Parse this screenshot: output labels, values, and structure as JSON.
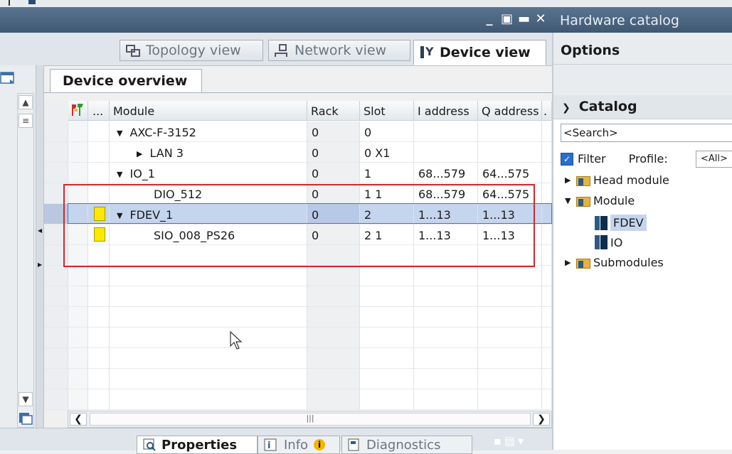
{
  "window": {
    "controls": [
      "_",
      "▣",
      "▬",
      "✕"
    ]
  },
  "view_tabs": [
    {
      "label": "Topology view",
      "icon": "topology-icon",
      "active": false
    },
    {
      "label": "Network view",
      "icon": "network-icon",
      "active": false
    },
    {
      "label": "Device view",
      "icon": "device-icon",
      "active": true
    }
  ],
  "overview": {
    "tab_label": "Device overview",
    "columns": [
      "...",
      "Module",
      "Rack",
      "Slot",
      "I address",
      "Q address"
    ],
    "rows": [
      {
        "module": "AXC-F-3152",
        "rack": "0",
        "slot": "0",
        "i_address": "",
        "q_address": "",
        "expander": "down",
        "indent": 0
      },
      {
        "module": "LAN 3",
        "rack": "0",
        "slot": "0 X1",
        "i_address": "",
        "q_address": "",
        "expander": "right",
        "indent": 1
      },
      {
        "module": "IO_1",
        "rack": "0",
        "slot": "1",
        "i_address": "68...579",
        "q_address": "64...575",
        "expander": "down",
        "indent": 0
      },
      {
        "module": "DIO_512",
        "rack": "0",
        "slot": "1 1",
        "i_address": "68...579",
        "q_address": "64...575",
        "expander": "",
        "indent": 2
      },
      {
        "module": "FDEV_1",
        "rack": "0",
        "slot": "2",
        "i_address": "1...13",
        "q_address": "1...13",
        "expander": "down",
        "indent": 0,
        "selected": true,
        "flag": true
      },
      {
        "module": "SIO_008_PS26",
        "rack": "0",
        "slot": "2 1",
        "i_address": "1...13",
        "q_address": "1...13",
        "expander": "",
        "indent": 2,
        "flag": true
      }
    ]
  },
  "bottom_tabs": [
    {
      "label": "Properties",
      "active": true
    },
    {
      "label": "Info",
      "active": false
    },
    {
      "label": "Diagnostics",
      "active": false
    }
  ],
  "catalog_panel": {
    "title": "Hardware catalog",
    "options_label": "Options",
    "catalog_label": "Catalog",
    "search_placeholder": "<Search>",
    "filter_label": "Filter",
    "profile_label": "Profile:",
    "profile_value": "<All>",
    "tree": [
      {
        "label": "Head module",
        "expander": "right",
        "level": 0,
        "icon": "folder"
      },
      {
        "label": "Module",
        "expander": "down",
        "level": 0,
        "icon": "folder"
      },
      {
        "label": "FDEV",
        "expander": "",
        "level": 1,
        "icon": "module",
        "selected": true
      },
      {
        "label": "IO",
        "expander": "",
        "level": 1,
        "icon": "module"
      },
      {
        "label": "Submodules",
        "expander": "right",
        "level": 0,
        "icon": "folder"
      }
    ]
  },
  "colors": {
    "title_bar": "#4a6481",
    "selection": "#c5d5ee",
    "highlight_box": "#d4262d",
    "flag_yellow": "#ffe800"
  }
}
